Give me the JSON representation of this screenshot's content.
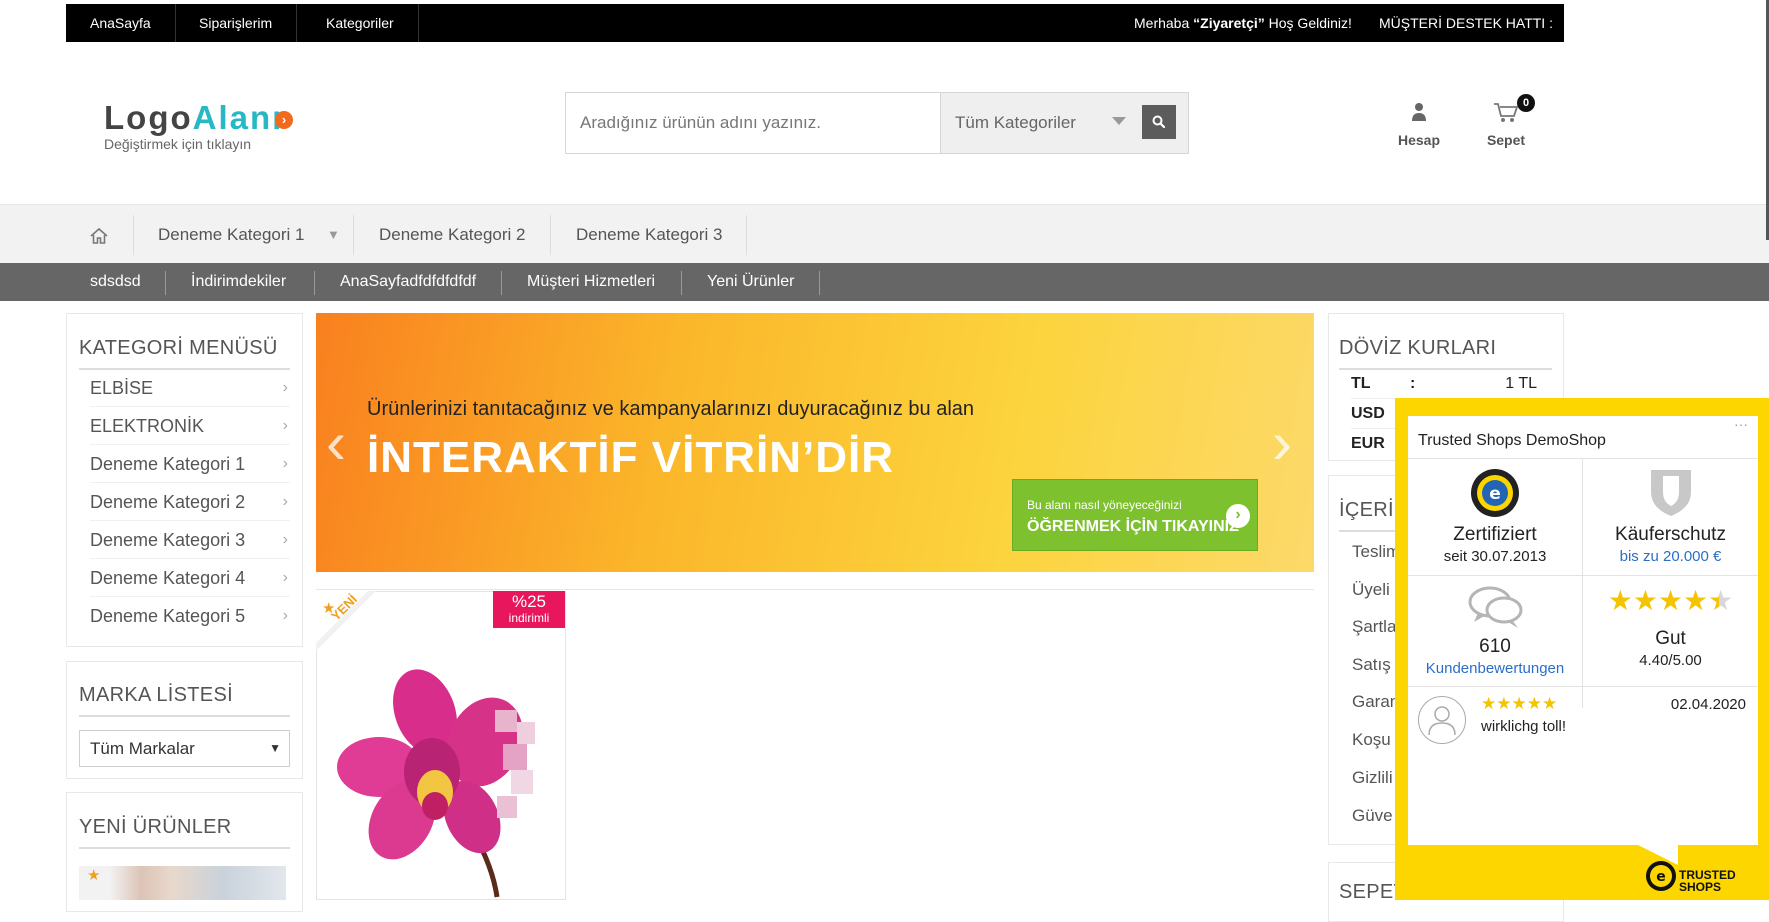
{
  "topbar": {
    "home": "AnaSayfa",
    "orders": "Siparişlerim",
    "categories": "Kategoriler",
    "greeting_pre": "Merhaba ",
    "greeting_name": "“Ziyaretçi”",
    "greeting_post": " Hoş Geldiniz!",
    "support": "MÜŞTERİ DESTEK HATTI :"
  },
  "logo": {
    "part1": "Logo",
    "part2": "Alanı",
    "subtitle": "Değiştirmek için tıklayın"
  },
  "search": {
    "placeholder": "Aradığınız ürünün adını yazınız.",
    "category": "Tüm Kategoriler"
  },
  "header": {
    "account": "Hesap",
    "cart": "Sepet",
    "cart_count": "0"
  },
  "nav1": {
    "items": [
      "Deneme Kategori 1",
      "Deneme Kategori 2",
      "Deneme Kategori 3"
    ]
  },
  "nav2": {
    "items": [
      "sdsdsd",
      "İndirimdekiler",
      "AnaSayfadfdfdfdfdf",
      "Müşteri Hizmetleri",
      "Yeni Ürünler"
    ]
  },
  "category_menu": {
    "title": "KATEGORİ MENÜSÜ",
    "items": [
      "ELBİSE",
      "ELEKTRONİK",
      "Deneme Kategori 1",
      "Deneme Kategori 2",
      "Deneme Kategori 3",
      "Deneme Kategori 4",
      "Deneme Kategori 5"
    ]
  },
  "brand_list": {
    "title": "MARKA LİSTESİ",
    "selected": "Tüm Markalar"
  },
  "new_products": {
    "title": "YENİ ÜRÜNLER"
  },
  "banner": {
    "line1": "Ürünlerinizi tanıtacağınız ve kampanyalarınızı duyuracağınız bu alan",
    "line2": "İNTERAKTİF VİTRİN’DİR",
    "cta_small": "Bu alanı nasıl yöneyeceğinizi",
    "cta_big": "ÖĞRENMEK İÇİN TIKAYINIZ"
  },
  "product": {
    "new_label": "YENİ",
    "discount_percent": "%25",
    "discount_label": "indirimli"
  },
  "currency": {
    "title": "DÖVİZ KURLARI",
    "rows": [
      {
        "code": "TL",
        "sep": ":",
        "value": "1 TL"
      },
      {
        "code": "USD",
        "sep": "",
        "value": ""
      },
      {
        "code": "EUR",
        "sep": "",
        "value": ""
      }
    ]
  },
  "content": {
    "title": "İÇERİK",
    "items": [
      "Teslim",
      "Üyeli",
      "Şartla",
      "Satış",
      "Garan",
      "Koşu",
      "Gizlili",
      "Güve"
    ]
  },
  "cart_panel": {
    "title": "SEPET"
  },
  "trusted_shops": {
    "title": "Trusted Shops DemoShop",
    "menu": "···",
    "cert_title": "Zertifiziert",
    "cert_since": "seit 30.07.2013",
    "protection_title": "Käuferschutz",
    "protection_amount": "bis zu 20.000 €",
    "reviews_count": "610",
    "reviews_label": "Kundenbewertungen",
    "rating_word": "Gut",
    "rating_value": "4.40/5.00",
    "rating_stars": 4.4,
    "review_date": "02.04.2020",
    "review_text": "wirklichg toll!",
    "review_stars": 5,
    "brand_line1": "TRUSTED",
    "brand_line2": "SHOPS",
    "colors": {
      "yellow": "#fdd600",
      "link": "#2b6ec9",
      "star": "#f5c400"
    }
  }
}
